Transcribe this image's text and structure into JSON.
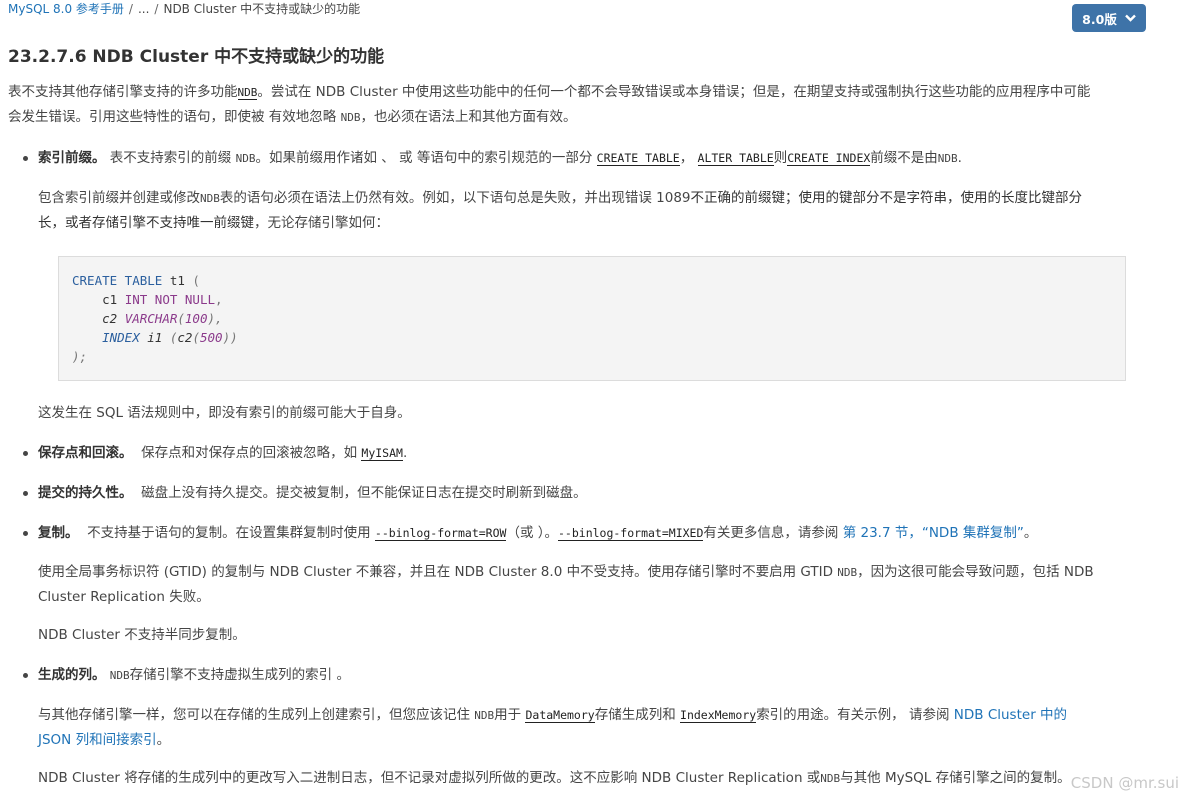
{
  "breadcrumb": {
    "root": "MySQL 8.0 参考手册",
    "ellipsis": "...",
    "current": "NDB Cluster 中不支持或缺少的功能"
  },
  "version_button": {
    "label": "8.0版"
  },
  "title": "23.2.7.6 NDB Cluster 中不支持或缺少的功能",
  "intro": {
    "a": "表不支持其他存储引擎支持的许多功能",
    "ndb": "NDB",
    "b": "。尝试在 NDB Cluster 中使用这些功能中的任何一个都不会导致错误或本身错误；但是，在期望支持或强制执行这些功能的应用程序中可能",
    "c": "会发生错误。引用这些特性的语句，即使被 有效地忽略 ",
    "ndb2": "NDB",
    "d": "，也必须在语法上和其他方面有效。"
  },
  "index_prefixes": {
    "title": "索引前缀。",
    "a": "表不支持索引的前缀 ",
    "ndb": "NDB",
    "b": "。如果前缀用作诸如 、 或 等语句中的索引规范的一部分 ",
    "c1": "CREATE TABLE",
    "sep1": "，",
    "c2": "ALTER TABLE",
    "then": "则",
    "c3": "CREATE INDEX",
    "tail": "前缀不是由",
    "ndb_tail": "NDB",
    "end": ".",
    "p2_a": "包含索引前缀并创建或修改",
    "p2_ndb": "NDB",
    "p2_b": "表的语句必须在语法上仍然有效。例如，以下语句总是失败，并出现错误 1089",
    "p2_err": "不正确的前缀键；使用的键部分不是字符串，使用的长度比键部分",
    "p2_err2": "长，或者存储引擎不支持唯一前缀键",
    "p2_c": "，无论存储引擎如何：",
    "after": "这发生在 SQL 语法规则中，即没有索引的前缀可能大于自身。"
  },
  "code": {
    "l1_kw": "CREATE TABLE",
    "l1_name": " t1 ",
    "l1_paren": "(",
    "l2_col": "    c1 ",
    "l2_type": "INT",
    "l2_sp": " ",
    "l2_nn": "NOT NULL",
    "l2_end": ",",
    "l3_col": "    c2 ",
    "l3_type": "VARCHAR",
    "l3_open": "(",
    "l3_num": "100",
    "l3_close": "),",
    "l4_ind": "    ",
    "l4_kw": "INDEX",
    "l4_name": " i1 ",
    "l4_open": "(",
    "l4_col": "c2",
    "l4_o2": "(",
    "l4_num": "500",
    "l4_close": "))",
    "l5": ");"
  },
  "savepoints": {
    "title": "保存点和回滚。",
    "a": "保存点和对保存点的回滚被忽略，如 ",
    "code": "MyISAM",
    "end": "."
  },
  "durability": {
    "title": "提交的持久性。",
    "text": "磁盘上没有持久提交。提交被复制，但不能保证日志在提交时刷新到磁盘。"
  },
  "replication": {
    "title": "复制。",
    "a": "不支持基于语句的复制。在设置集群复制时使用 ",
    "c1": "--binlog-format=ROW",
    "b": "（或 ）。",
    "c2": "--binlog-format=MIXED",
    "c": "有关更多信息，请参阅 ",
    "link": "第 23.7 节，“NDB 集群复制”",
    "end": "。",
    "p2a": "使用全局事务标识符 (GTID) 的复制与 NDB Cluster 不兼容，并且在 NDB Cluster 8.0 中不受支持。使用存储引擎时不要启用 GTID ",
    "p2ndb": "NDB",
    "p2b": "，因为这很可能会导致问题，包括 NDB",
    "p2c": "Cluster Replication 失败。",
    "p3": "NDB Cluster 不支持半同步复制。"
  },
  "generated": {
    "title": "生成的列。",
    "ndb": "NDB",
    "a": "存储引擎不支持虚拟生成列的索引 。",
    "p2a": "与其他存储引擎一样，您可以在存储的生成列上创建索引，但您应该记住 ",
    "p2ndb": "NDB",
    "p2b": "用于 ",
    "c1": "DataMemory",
    "p2c": "存储生成列和 ",
    "c2": "IndexMemory",
    "p2d": "索引的用途。有关示例， 请参阅 ",
    "link": "NDB Cluster 中的",
    "link2": "JSON 列和间接索引",
    "p2e": "。",
    "p3a": "NDB Cluster 将存储的生成列中的更改写入二进制日志，但不记录对虚拟列所做的更改。这不应影响 NDB Cluster Replication 或",
    "p3ndb": "NDB",
    "p3b": "与其他 MySQL 存储引擎之间的复制。"
  },
  "watermark": "CSDN @mr.sui"
}
